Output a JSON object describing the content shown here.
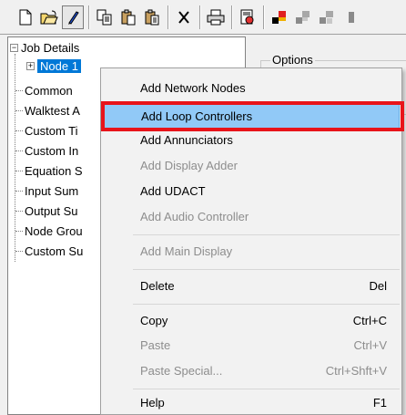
{
  "toolbar": {
    "buttons": [
      "new-document-icon",
      "open-folder-icon",
      "edit-pencil-icon",
      "copy-icon",
      "paste-icon",
      "paste-special-icon",
      "delete-x-icon",
      "print-icon",
      "report-icon",
      "tool-a-icon",
      "tool-b-icon",
      "tool-c-icon",
      "tool-d-icon"
    ]
  },
  "tree": {
    "root_label": "Job Details",
    "node_label": "Node 1",
    "items": [
      "Common",
      "Walktest A",
      "Custom Ti",
      "Custom In",
      "Equation S",
      "Input Sum",
      "Output Su",
      "Node Grou",
      "Custom Su"
    ]
  },
  "options": {
    "group_title": "Options"
  },
  "context_menu": {
    "items": [
      {
        "label": "Add Network Nodes",
        "shortcut": "",
        "disabled": false
      },
      {
        "label": "Add Loop Controllers",
        "shortcut": "",
        "disabled": false,
        "highlighted": true
      },
      {
        "label": "Add Annunciators",
        "shortcut": "",
        "disabled": false
      },
      {
        "label": "Add Display Adder",
        "shortcut": "",
        "disabled": true
      },
      {
        "label": "Add UDACT",
        "shortcut": "",
        "disabled": false
      },
      {
        "label": "Add Audio Controller",
        "shortcut": "",
        "disabled": true
      },
      {
        "label": "Add Main Display",
        "shortcut": "",
        "disabled": true
      },
      {
        "label": "Delete",
        "shortcut": "Del",
        "disabled": false
      },
      {
        "label": "Copy",
        "shortcut": "Ctrl+C",
        "disabled": false
      },
      {
        "label": "Paste",
        "shortcut": "Ctrl+V",
        "disabled": true
      },
      {
        "label": "Paste Special...",
        "shortcut": "Ctrl+Shft+V",
        "disabled": true
      },
      {
        "label": "Help",
        "shortcut": "F1",
        "disabled": false
      }
    ],
    "highlight_color": "#91c9f7",
    "annotation_box_color": "#e8141a"
  }
}
